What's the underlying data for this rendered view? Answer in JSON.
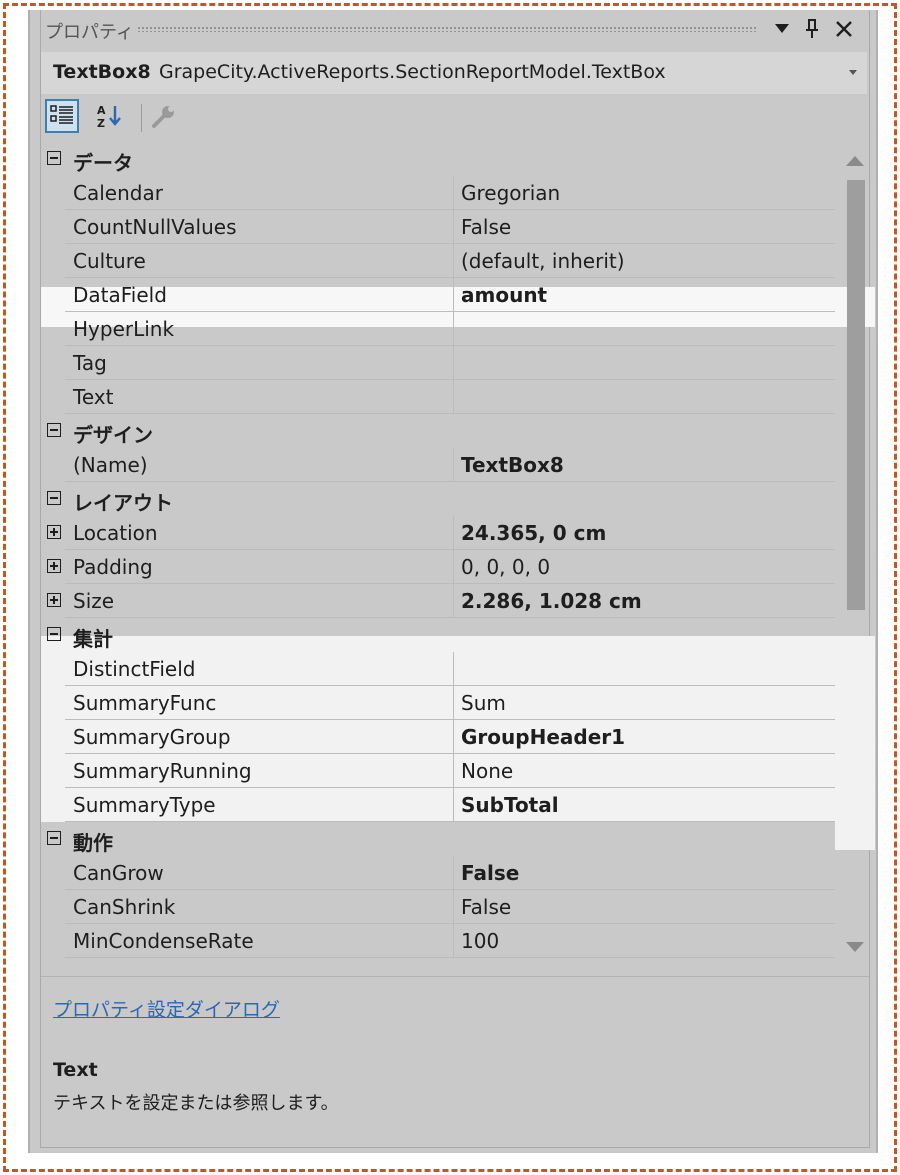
{
  "window": {
    "title": "プロパティ"
  },
  "object_selector": {
    "name": "TextBox8",
    "type": "GrapeCity.ActiveReports.SectionReportModel.TextBox"
  },
  "icons": {
    "dropdown": "triangle-down-icon",
    "pin": "pin-icon",
    "close": "close-icon",
    "categorized": "categorized-view-icon",
    "alphabetical": "alphabetical-sort-icon",
    "property_pages": "wrench-icon"
  },
  "grid": {
    "rows": [
      {
        "kind": "category",
        "label": "データ",
        "expanded": true
      },
      {
        "kind": "prop",
        "label": "Calendar",
        "value": "Gregorian",
        "bold": false
      },
      {
        "kind": "prop",
        "label": "CountNullValues",
        "value": "False",
        "bold": false
      },
      {
        "kind": "prop",
        "label": "Culture",
        "value": "(default, inherit)",
        "bold": false
      },
      {
        "kind": "prop",
        "label": "DataField",
        "value": "amount",
        "bold": true,
        "highlighted": true
      },
      {
        "kind": "prop",
        "label": "HyperLink",
        "value": "",
        "bold": false
      },
      {
        "kind": "prop",
        "label": "Tag",
        "value": "",
        "bold": false
      },
      {
        "kind": "prop",
        "label": "Text",
        "value": "",
        "bold": false
      },
      {
        "kind": "category",
        "label": "デザイン",
        "expanded": true
      },
      {
        "kind": "prop",
        "label": "(Name)",
        "value": "TextBox8",
        "bold": true
      },
      {
        "kind": "category",
        "label": "レイアウト",
        "expanded": true
      },
      {
        "kind": "prop",
        "label": "Location",
        "value": "24.365, 0 cm",
        "bold": true,
        "expandable": true
      },
      {
        "kind": "prop",
        "label": "Padding",
        "value": "0, 0, 0, 0",
        "bold": false,
        "expandable": true
      },
      {
        "kind": "prop",
        "label": "Size",
        "value": "2.286, 1.028 cm",
        "bold": true,
        "expandable": true
      },
      {
        "kind": "category",
        "label": "集計",
        "expanded": true,
        "highlighted": true
      },
      {
        "kind": "prop",
        "label": "DistinctField",
        "value": "",
        "bold": false,
        "highlighted": true
      },
      {
        "kind": "prop",
        "label": "SummaryFunc",
        "value": "Sum",
        "bold": false,
        "highlighted": true
      },
      {
        "kind": "prop",
        "label": "SummaryGroup",
        "value": "GroupHeader1",
        "bold": true,
        "highlighted": true
      },
      {
        "kind": "prop",
        "label": "SummaryRunning",
        "value": "None",
        "bold": false,
        "highlighted": true
      },
      {
        "kind": "prop",
        "label": "SummaryType",
        "value": "SubTotal",
        "bold": true,
        "highlighted": true
      },
      {
        "kind": "category",
        "label": "動作",
        "expanded": true
      },
      {
        "kind": "prop",
        "label": "CanGrow",
        "value": "False",
        "bold": true
      },
      {
        "kind": "prop",
        "label": "CanShrink",
        "value": "False",
        "bold": false
      },
      {
        "kind": "prop",
        "label": "MinCondenseRate",
        "value": "100",
        "bold": false
      }
    ]
  },
  "commands": {
    "link": "プロパティ設定ダイアログ"
  },
  "description": {
    "title": "Text",
    "text": "テキストを設定または参照します。"
  },
  "colors": {
    "frame": "#c8561a",
    "panel": "#c9c9c9",
    "highlight": "#f7f7f7",
    "link": "#2b67b7"
  }
}
